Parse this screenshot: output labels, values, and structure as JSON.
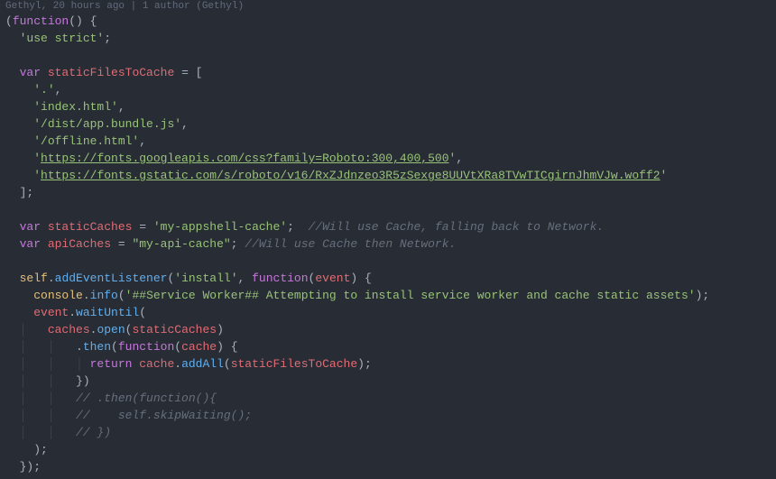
{
  "codelens": "Gethyl, 20 hours ago | 1 author (Gethyl)",
  "tokens": {
    "paren_open": "(",
    "paren_close": ")",
    "brace_open": "{",
    "brace_close": "}",
    "bracket_open": "[",
    "bracket_close": "]",
    "semi": ";",
    "comma": ",",
    "dot": ".",
    "eq": " = ",
    "function_kw": "function",
    "var_kw": "var",
    "return_kw": "return",
    "use_strict": "'use strict'",
    "staticFilesToCache": "staticFilesToCache",
    "sf_dot": "'.'",
    "sf_index": "'index.html'",
    "sf_bundle": "'/dist/app.bundle.js'",
    "sf_offline": "'/offline.html'",
    "sf_fontcss_q1": "'",
    "sf_fontcss_url": "https://fonts.googleapis.com/css?family=Roboto:300,400,500",
    "sf_fontcss_q2": "'",
    "sf_woff_q1": "'",
    "sf_woff_url": "https://fonts.gstatic.com/s/roboto/v16/RxZJdnzeo3R5zSexge8UUVtXRa8TVwTICgirnJhmVJw.woff2",
    "sf_woff_q2": "'",
    "staticCaches": "staticCaches",
    "staticCaches_val": "'my-appshell-cache'",
    "staticCaches_comment": "//Will use Cache, falling back to Network.",
    "apiCaches": "apiCaches",
    "apiCaches_val": "\"my-api-cache\"",
    "apiCaches_comment": "//Will use Cache then Network.",
    "self": "self",
    "addEventListener": "addEventListener",
    "install_str": "'install'",
    "event": "event",
    "console": "console",
    "info": "info",
    "info_str": "'##Service Worker## Attempting to install service worker and cache static assets'",
    "waitUntil": "waitUntil",
    "caches": "caches",
    "open": "open",
    "then": "then",
    "cache": "cache",
    "addAll": "addAll",
    "c_then": "// .then(function(){",
    "c_skip": "//    self.skipWaiting();",
    "c_end": "// })"
  }
}
